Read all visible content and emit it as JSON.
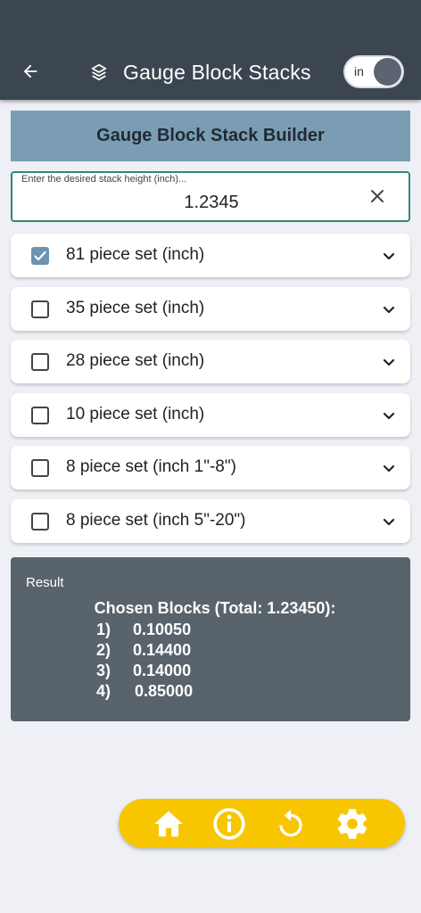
{
  "appbar": {
    "title": "Gauge Block Stacks",
    "toggle_label": "in",
    "icons": {
      "back": "arrow-left-icon",
      "title": "layers-icon"
    }
  },
  "builder": {
    "title": "Gauge Block Stack Builder",
    "input_label": "Enter the desired stack height (inch)...",
    "input_value": "1.2345"
  },
  "sets": [
    {
      "label": "81 piece set (inch)",
      "checked": true
    },
    {
      "label": "35 piece set (inch)",
      "checked": false
    },
    {
      "label": "28 piece set (inch)",
      "checked": false
    },
    {
      "label": "10 piece set (inch)",
      "checked": false
    },
    {
      "label": "8 piece set (inch 1\"-8\")",
      "checked": false
    },
    {
      "label": "8 piece set (inch 5\"-20\")",
      "checked": false
    }
  ],
  "result": {
    "title": "Result",
    "heading": "Chosen Blocks (Total: 1.23450):",
    "items": [
      {
        "num": "1)",
        "value": "0.10050"
      },
      {
        "num": "2)",
        "value": "0.14400"
      },
      {
        "num": "3)",
        "value": "0.14000"
      },
      {
        "num": "4)",
        "value": "0.85000"
      }
    ]
  },
  "bottom_nav": {
    "icons": [
      "home-icon",
      "info-icon",
      "refresh-icon",
      "settings-icon"
    ]
  },
  "colors": {
    "appbar": "#3b4650",
    "header": "#7b9db4",
    "accent_border": "#2f8a70",
    "checkbox_checked": "#6e93b0",
    "result_bg": "#58636b",
    "bottom_bar": "#f7c600"
  }
}
